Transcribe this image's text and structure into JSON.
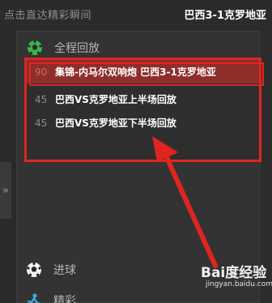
{
  "header": {
    "left_label": "点击直达精彩瞬间",
    "match_title": "巴西3-1克罗地亚"
  },
  "expand_handle": {
    "glyph": "»"
  },
  "categories": [
    {
      "label": "全程回放",
      "icon": "soccer-ball-green-icon"
    },
    {
      "label": "进球",
      "icon": "soccer-ball-icon"
    },
    {
      "label": "精彩",
      "icon": "player-kick-icon"
    }
  ],
  "replay_items": [
    {
      "minute": "90",
      "title": "集锦-内马尔双响炮 巴西3-1克罗地亚",
      "active": true
    },
    {
      "minute": "45",
      "title": "巴西VS克罗地亚上半场回放",
      "active": false
    },
    {
      "minute": "45",
      "title": "巴西VS克罗地亚下半场回放",
      "active": false
    }
  ],
  "watermark": {
    "brand": "Bai度经验",
    "url": "jingyan.baidu.com"
  },
  "colors": {
    "highlight_red": "#e0251f",
    "active_row": "#8e2e2a",
    "accent_green": "#39b54a"
  }
}
